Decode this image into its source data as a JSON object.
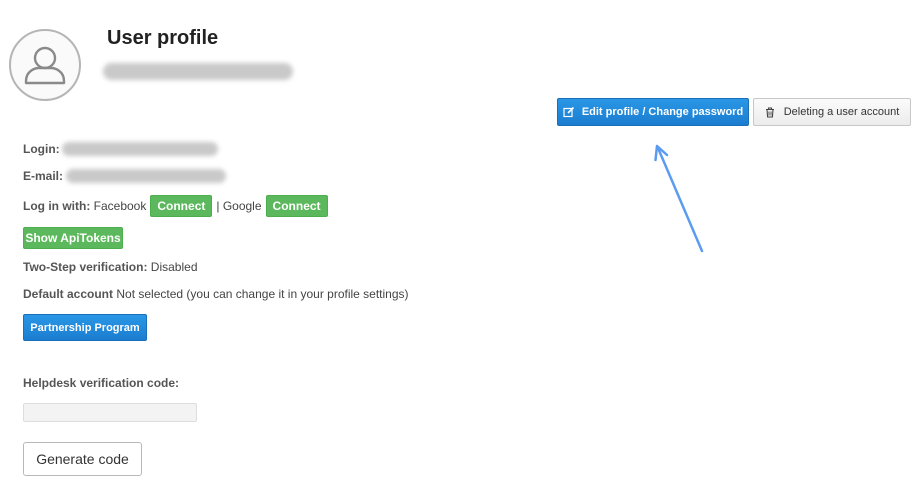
{
  "profile": {
    "title": "User profile",
    "avatar_icon": "user-silhouette-icon"
  },
  "actions": {
    "edit_label": "Edit profile / Change password",
    "edit_icon": "edit-icon",
    "delete_label": "Deleting a user account",
    "delete_icon": "trash-icon"
  },
  "details": {
    "login_label": "Login:",
    "email_label": "E-mail:",
    "login_with_label": "Log in with:",
    "facebook_text": "Facebook",
    "separator": "|",
    "google_text": "Google",
    "connect_label": "Connect",
    "api_tokens_label": "Show ApiTokens",
    "two_step_label": "Two-Step verification:",
    "two_step_value": "Disabled",
    "default_account_label": "Default account",
    "default_account_value": "Not selected (you can change it in your profile settings)",
    "partnership_label": "Partnership Program"
  },
  "helpdesk": {
    "label": "Helpdesk verification code:",
    "value": "",
    "placeholder": "",
    "generate_label": "Generate code"
  },
  "colors": {
    "primary_blue": "#1b7dd0",
    "success_green": "#5cb85c",
    "annotation_arrow": "#5b9bf0"
  }
}
